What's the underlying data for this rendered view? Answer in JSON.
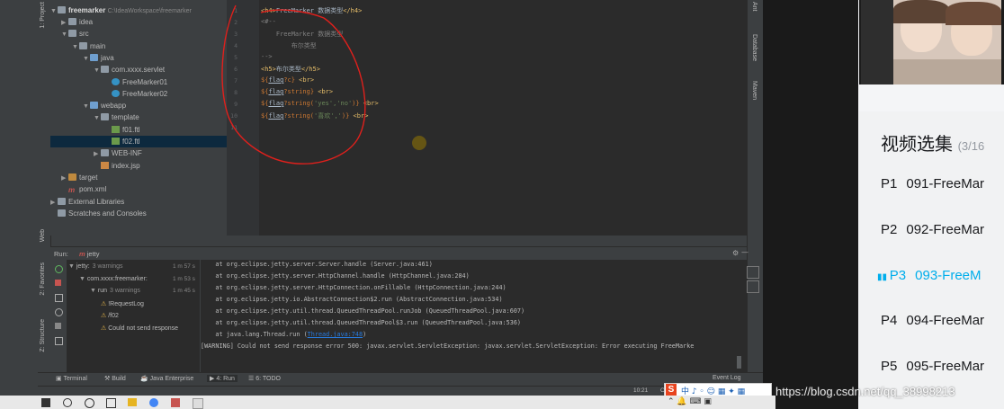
{
  "project": {
    "root_name": "freemarker",
    "root_path": "C:\\IdeaWorkspace\\freemarker",
    "items": [
      {
        "label": "idea",
        "indent": 1,
        "arrow": "▶",
        "icon": "folder"
      },
      {
        "label": "src",
        "indent": 1,
        "arrow": "▼",
        "icon": "folder"
      },
      {
        "label": "main",
        "indent": 2,
        "arrow": "▼",
        "icon": "folder"
      },
      {
        "label": "java",
        "indent": 3,
        "arrow": "▼",
        "icon": "folder-blue"
      },
      {
        "label": "com.xxxx.servlet",
        "indent": 4,
        "arrow": "▼",
        "icon": "folder"
      },
      {
        "label": "FreeMarker01",
        "indent": 5,
        "arrow": "",
        "icon": "class"
      },
      {
        "label": "FreeMarker02",
        "indent": 5,
        "arrow": "",
        "icon": "class"
      },
      {
        "label": "webapp",
        "indent": 3,
        "arrow": "▼",
        "icon": "folder-blue"
      },
      {
        "label": "template",
        "indent": 4,
        "arrow": "▼",
        "icon": "folder"
      },
      {
        "label": "f01.ftl",
        "indent": 5,
        "arrow": "",
        "icon": "ftl"
      },
      {
        "label": "f02.ftl",
        "indent": 5,
        "arrow": "",
        "icon": "ftl",
        "selected": true
      },
      {
        "label": "WEB-INF",
        "indent": 4,
        "arrow": "▶",
        "icon": "folder"
      },
      {
        "label": "index.jsp",
        "indent": 4,
        "arrow": "",
        "icon": "jsp"
      },
      {
        "label": "target",
        "indent": 1,
        "arrow": "▶",
        "icon": "folder-orange"
      },
      {
        "label": "pom.xml",
        "indent": 1,
        "arrow": "",
        "icon": "maven"
      },
      {
        "label": "External Libraries",
        "indent": 0,
        "arrow": "▶",
        "icon": "folder"
      },
      {
        "label": "Scratches and Consoles",
        "indent": 0,
        "arrow": "",
        "icon": "folder"
      }
    ]
  },
  "left_strip": {
    "project_label": "1: Project",
    "web_label": "Web",
    "favorites_label": "2: Favorites",
    "structure_label": "Z: Structure"
  },
  "right_strip": {
    "ant_label": "Ant",
    "database_label": "Database",
    "maven_label": "Maven"
  },
  "editor": {
    "line_numbers": [
      "1",
      "2",
      "3",
      "4",
      "5",
      "6",
      "7",
      "8",
      "9",
      "10",
      "11"
    ],
    "lines": {
      "l1a": "<h4>",
      "l1b": "FreeMarker 数据类型",
      "l1c": "</h4>",
      "l2": "<#--",
      "l3": "    FreeMarker 数据类型",
      "l4": "        布尔类型",
      "l5": "-->",
      "l6a": "<h5>",
      "l6b": "布尔类型",
      "l6c": "</h5>",
      "l7a": "${",
      "l7b": "flag",
      "l7c": "?c",
      "l7d": "} ",
      "l7e": "<br>",
      "l8a": "${",
      "l8b": "flag",
      "l8c": "?string",
      "l8d": "} ",
      "l8e": "<br>",
      "l9a": "${",
      "l9b": "flag",
      "l9c": "?string(",
      "l9s": "'yes','no'",
      "l9d": ")} ",
      "l9e": "<br>",
      "l10a": "${",
      "l10b": "flag",
      "l10c": "?string(",
      "l10s": "'喜欢',",
      "l10d": "'",
      "l10f": ")} ",
      "l10e": "<br>"
    }
  },
  "run": {
    "label": "Run:",
    "config": "jetty",
    "tree": [
      {
        "label": "jetty:",
        "sub": "3 warnings",
        "time": "1 m 57 s",
        "indent": 0
      },
      {
        "label": "com.xxxx:freemarker:",
        "sub": "",
        "time": "1 m 53 s",
        "indent": 1
      },
      {
        "label": "run",
        "sub": "3 warnings",
        "time": "1 m 45 s",
        "indent": 2
      },
      {
        "label": "!RequestLog",
        "sub": "",
        "time": "",
        "indent": 3
      },
      {
        "label": "/f02",
        "sub": "",
        "time": "",
        "indent": 3
      },
      {
        "label": "Could not send response",
        "sub": "",
        "time": "",
        "indent": 3
      }
    ],
    "console": [
      "    at org.eclipse.jetty.server.Server.handle (Server.java:461)",
      "    at org.eclipse.jetty.server.HttpChannel.handle (HttpChannel.java:284)",
      "    at org.eclipse.jetty.server.HttpConnection.onFillable (HttpConnection.java:244)",
      "    at org.eclipse.jetty.io.AbstractConnection$2.run (AbstractConnection.java:534)",
      "    at org.eclipse.jetty.util.thread.QueuedThreadPool.runJob (QueuedThreadPool.java:607)",
      "    at org.eclipse.jetty.util.thread.QueuedThreadPool$3.run (QueuedThreadPool.java:536)"
    ],
    "console_last_prefix": "    at java.lang.Thread.run (",
    "console_last_link": "Thread.java:748",
    "console_last_suffix": ")",
    "warning_line": "[WARNING] Could not send response error 500: javax.servlet.ServletException: javax.servlet.ServletException: Error executing FreeMarke"
  },
  "bottom_tabs": {
    "terminal": "Terminal",
    "build": "Build",
    "java_enterprise": "Java Enterprise",
    "run": "4: Run",
    "todo": "6: TODO",
    "event_log": "Event Log"
  },
  "status": {
    "position": "10:21",
    "encoding": "CR"
  },
  "episodes": {
    "title": "视频选集",
    "count": "(3/16",
    "items": [
      {
        "num": "P1",
        "title": "091-FreeMar"
      },
      {
        "num": "P2",
        "title": "092-FreeMar"
      },
      {
        "num": "P3",
        "title": "093-FreeM",
        "active": true
      },
      {
        "num": "P4",
        "title": "094-FreeMar"
      },
      {
        "num": "P5",
        "title": "095-FreeMar"
      }
    ]
  },
  "watermark": "https://blog.csdn.net/qq_38998213",
  "colors": {
    "accent": "#00aeec",
    "annotation": "#e0201c",
    "ide_bg": "#2b2b2b"
  }
}
